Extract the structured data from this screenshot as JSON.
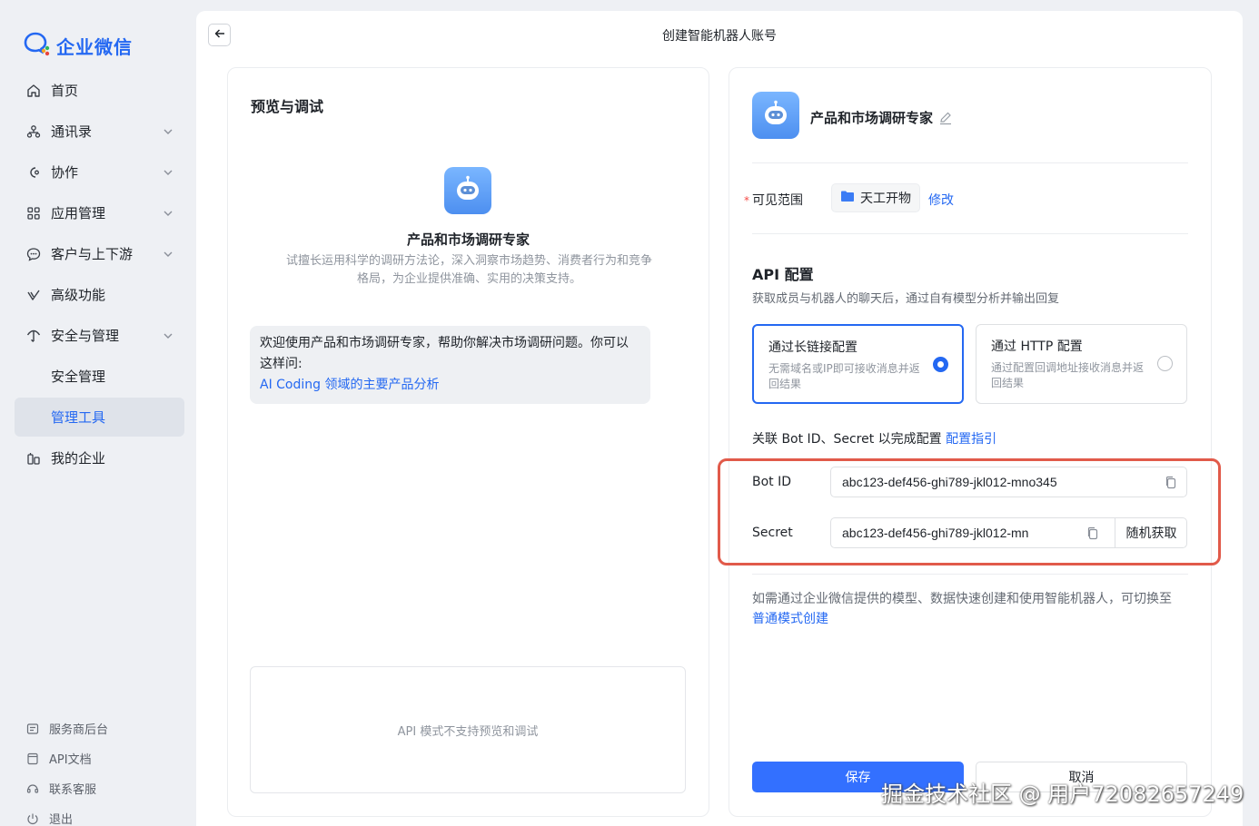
{
  "app": {
    "brand": "企业微信",
    "brand_color": "#2468f2"
  },
  "sidebar": {
    "items": [
      {
        "label": "首页",
        "icon": "home-icon"
      },
      {
        "label": "通讯录",
        "icon": "contacts-icon"
      },
      {
        "label": "协作",
        "icon": "collaboration-icon"
      },
      {
        "label": "应用管理",
        "icon": "apps-icon"
      },
      {
        "label": "客户与上下游",
        "icon": "chat-icon"
      },
      {
        "label": "高级功能",
        "icon": "advanced-icon"
      },
      {
        "label": "安全与管理",
        "icon": "security-icon"
      },
      {
        "label": "安全管理"
      },
      {
        "label": "管理工具",
        "active": true
      },
      {
        "label": "我的企业",
        "icon": "enterprise-icon"
      }
    ],
    "bottom": [
      {
        "label": "服务商后台",
        "icon": "provider-icon"
      },
      {
        "label": "API文档",
        "icon": "doc-icon"
      },
      {
        "label": "联系客服",
        "icon": "support-icon"
      },
      {
        "label": "退出",
        "icon": "logout-icon"
      }
    ]
  },
  "header": {
    "title": "创建智能机器人账号"
  },
  "preview": {
    "title": "预览与调试",
    "bot_name": "产品和市场调研专家",
    "bot_desc": "试擅长运用科学的调研方法论，深入洞察市场趋势、消费者行为和竞争格局，为企业提供准确、实用的决策支持。",
    "welcome_text": "欢迎使用产品和市场调研专家，帮助你解决市场调研问题。你可以这样问:",
    "welcome_link": "AI Coding 领域的主要产品分析",
    "no_preview": "API 模式不支持预览和调试"
  },
  "config": {
    "bot_name": "产品和市场调研专家",
    "scope_label": "可见范围",
    "scope_required": "*",
    "scope_value": "天工开物",
    "modify_label": "修改",
    "api_title": "API 配置",
    "api_desc": "获取成员与机器人的聊天后，通过自有模型分析并输出回复",
    "options": [
      {
        "title": "通过长链接配置",
        "desc": "无需域名或IP即可接收消息并返回结果",
        "selected": true
      },
      {
        "title": "通过 HTTP 配置",
        "desc": "通过配置回调地址接收消息并返回结果",
        "selected": false
      }
    ],
    "bind_text": "关联 Bot ID、Secret 以完成配置",
    "bind_link": "配置指引",
    "bot_id_label": "Bot ID",
    "bot_id_value": "abc123-def456-ghi789-jkl012-mno345",
    "secret_label": "Secret",
    "secret_value": "abc123-def456-ghi789-jkl012-mn",
    "random_label": "随机获取",
    "switch_text": "如需通过企业微信提供的模型、数据快速创建和使用智能机器人，可切换至",
    "switch_link": "普通模式创建",
    "save_label": "保存",
    "cancel_label": "取消"
  },
  "watermark": "掘金技术社区 @ 用户72082657249",
  "colors": {
    "accent": "#2468f2",
    "highlight": "#e15a4a",
    "primary_button": "#3370ff"
  }
}
